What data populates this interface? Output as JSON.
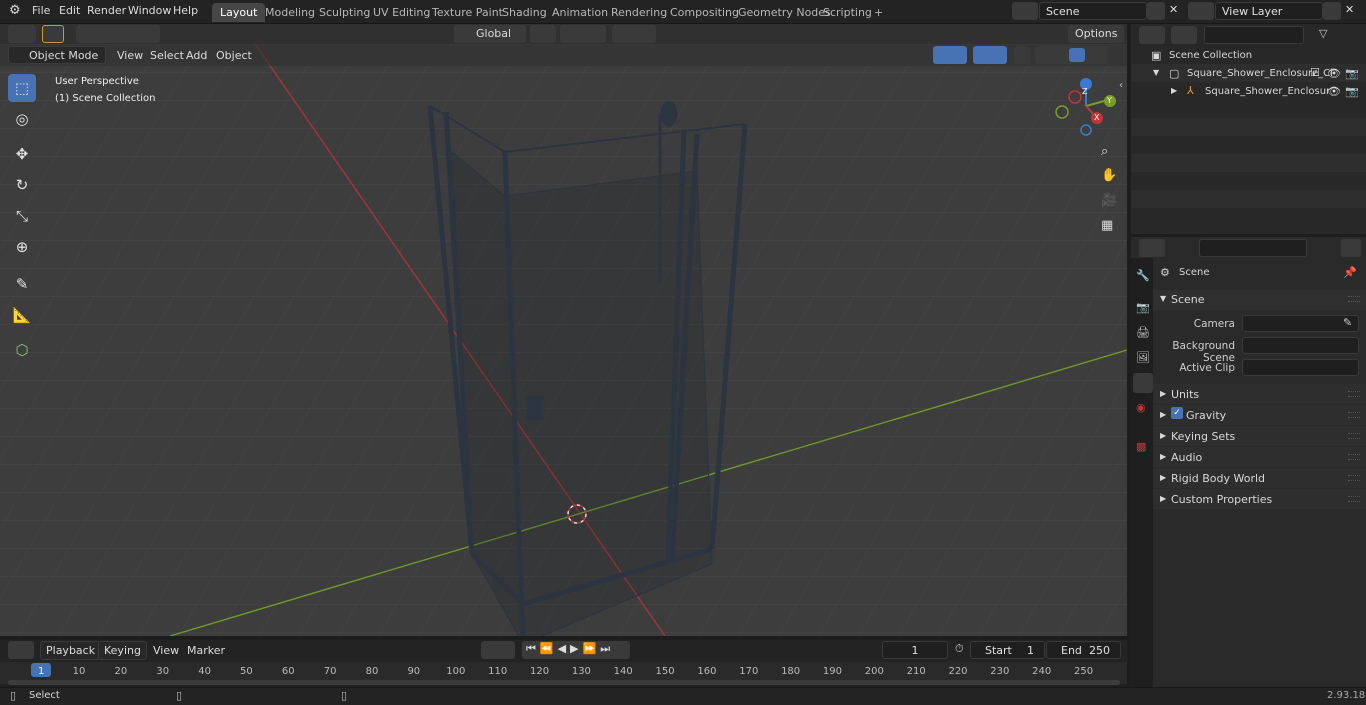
{
  "topbar": {
    "menus": [
      "File",
      "Edit",
      "Render",
      "Window",
      "Help"
    ],
    "workspaces": [
      "Layout",
      "Modeling",
      "Sculpting",
      "UV Editing",
      "Texture Paint",
      "Shading",
      "Animation",
      "Rendering",
      "Compositing",
      "Geometry Nodes",
      "Scripting"
    ],
    "active_workspace": "Layout",
    "add_tab": "+",
    "scene_name": "Scene",
    "view_layer": "View Layer"
  },
  "viewport_header": {
    "transform_orientation": "Global",
    "options": "Options",
    "mode": "Object Mode",
    "menus": [
      "View",
      "Select",
      "Add",
      "Object"
    ]
  },
  "viewport": {
    "overlay_line1": "User Perspective",
    "overlay_line2": "(1) Scene Collection",
    "gizmo_axes": [
      "X",
      "Y",
      "Z"
    ]
  },
  "outliner": {
    "root": "Scene Collection",
    "items": [
      {
        "label": "Square_Shower_Enclosure_Cl"
      },
      {
        "label": "Square_Shower_Enclosur"
      }
    ]
  },
  "properties": {
    "context": "Scene",
    "panel_title": "Scene",
    "fields": [
      {
        "label": "Camera"
      },
      {
        "label": "Background Scene"
      },
      {
        "label": "Active Clip"
      }
    ],
    "sections": [
      "Units",
      "Gravity",
      "Keying Sets",
      "Audio",
      "Rigid Body World",
      "Custom Properties"
    ],
    "gravity_checked": true
  },
  "timeline": {
    "menus": [
      "Playback",
      "Keying",
      "View",
      "Marker"
    ],
    "current_frame": "1",
    "start_label": "Start",
    "start": "1",
    "end_label": "End",
    "end": "250",
    "ticks": [
      "1",
      "10",
      "20",
      "30",
      "40",
      "50",
      "60",
      "70",
      "80",
      "90",
      "100",
      "110",
      "120",
      "130",
      "140",
      "150",
      "160",
      "170",
      "180",
      "190",
      "200",
      "210",
      "220",
      "230",
      "240",
      "250"
    ]
  },
  "status": {
    "left": "Select",
    "version": "2.93.18"
  },
  "colors": {
    "accent": "#4772b3",
    "x_axis": "#c0363b",
    "y_axis": "#7a9d2a",
    "viewport_bg": "#3d3d3d"
  }
}
